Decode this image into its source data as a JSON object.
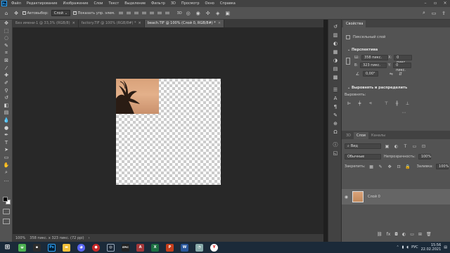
{
  "menu": {
    "items": [
      "Файл",
      "Редактирование",
      "Изображение",
      "Слои",
      "Текст",
      "Выделение",
      "Фильтр",
      "3D",
      "Просмотр",
      "Окно",
      "Справка"
    ]
  },
  "options_bar": {
    "autoselect_label": "Автовыбор:",
    "autoselect_value": "Слой",
    "show_controls_label": "Показать упр. элем."
  },
  "tabs": [
    {
      "label": "Без имени-1 @ 33,3% (RGB/8)",
      "close": "×"
    },
    {
      "label": "factory.TIF @ 100% (RGB/8#) *",
      "close": "×"
    },
    {
      "label": "beach.TIF @ 100% (Слой 0, RGB/8#) *",
      "close": "×"
    }
  ],
  "status_bar": {
    "zoom": "100%",
    "dimensions": "358 пикс. x 323 пикс. (72 ppi)"
  },
  "properties": {
    "tab": "Свойства",
    "layer_type": "Пиксельный слой",
    "transform_title": "Перспектива",
    "w_label": "Ш:",
    "w_value": "358 пикс.",
    "h_label": "В:",
    "h_value": "323 пикс.",
    "x_label": "X:",
    "x_value": "0 пикс.",
    "y_label": "Y:",
    "y_value": "0 пикс.",
    "angle_value": "0,00°",
    "align_title": "Выровнять и распределить",
    "align_label": "Выровнять:"
  },
  "layers_panel": {
    "tabs": [
      "3D",
      "Слои",
      "Каналы"
    ],
    "search_value": "Вид",
    "blend_mode": "Обычные",
    "opacity_label": "Непрозрачность:",
    "opacity_value": "100%",
    "lock_label": "Закрепить:",
    "fill_label": "Заливка:",
    "fill_value": "100%",
    "layer_name": "Слой 0",
    "visible": true
  },
  "taskbar": {
    "lang": "РУС",
    "time": "15:56",
    "date": "22.02.2021"
  },
  "colors": {
    "accent": "#31a8ff",
    "panel_bg": "#535353",
    "workspace_bg": "#282828",
    "photo_sky": "#e3b08a"
  }
}
